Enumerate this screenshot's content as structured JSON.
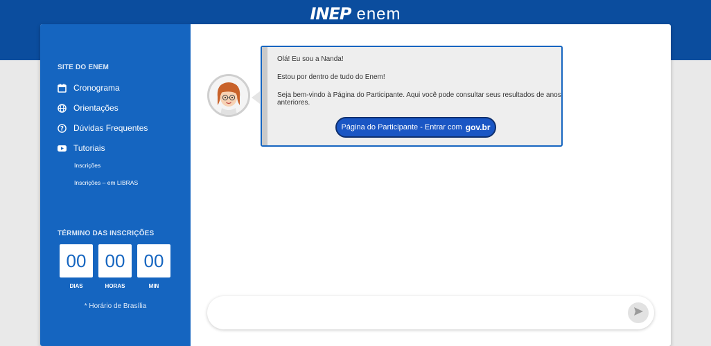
{
  "header": {
    "logo_inep": "INEP",
    "logo_enem": "enem"
  },
  "sidebar": {
    "section_title": "SITE DO ENEM",
    "items": [
      {
        "label": "Cronograma",
        "icon": "calendar-icon"
      },
      {
        "label": "Orientações",
        "icon": "globe-icon"
      },
      {
        "label": "Dúvidas Frequentes",
        "icon": "help-icon"
      },
      {
        "label": "Tutoriais",
        "icon": "video-icon"
      }
    ],
    "subitems": [
      {
        "label": "Inscrições"
      },
      {
        "label": "Inscrições – em LIBRAS"
      }
    ],
    "countdown": {
      "title": "TÉRMINO DAS INSCRIÇÕES",
      "days": "00",
      "hours": "00",
      "minutes": "00",
      "days_label": "DIAS",
      "hours_label": "HORAS",
      "minutes_label": "MIN",
      "note": "* Horário de Brasília"
    }
  },
  "chat": {
    "messages": [
      "Olá! Eu sou a Nanda!",
      "Estou por dentro de tudo do Enem!",
      "Seja bem-vindo à Página do Participante. Aqui você pode consultar seus resultados de anos anteriores."
    ],
    "button_label": "Página do Participante - Entrar com",
    "button_brand": "gov.br",
    "input_placeholder": "",
    "send_icon": "send-icon"
  },
  "colors": {
    "primary": "#1565c0",
    "header": "#0b4d9e",
    "button": "#1a56c4"
  }
}
